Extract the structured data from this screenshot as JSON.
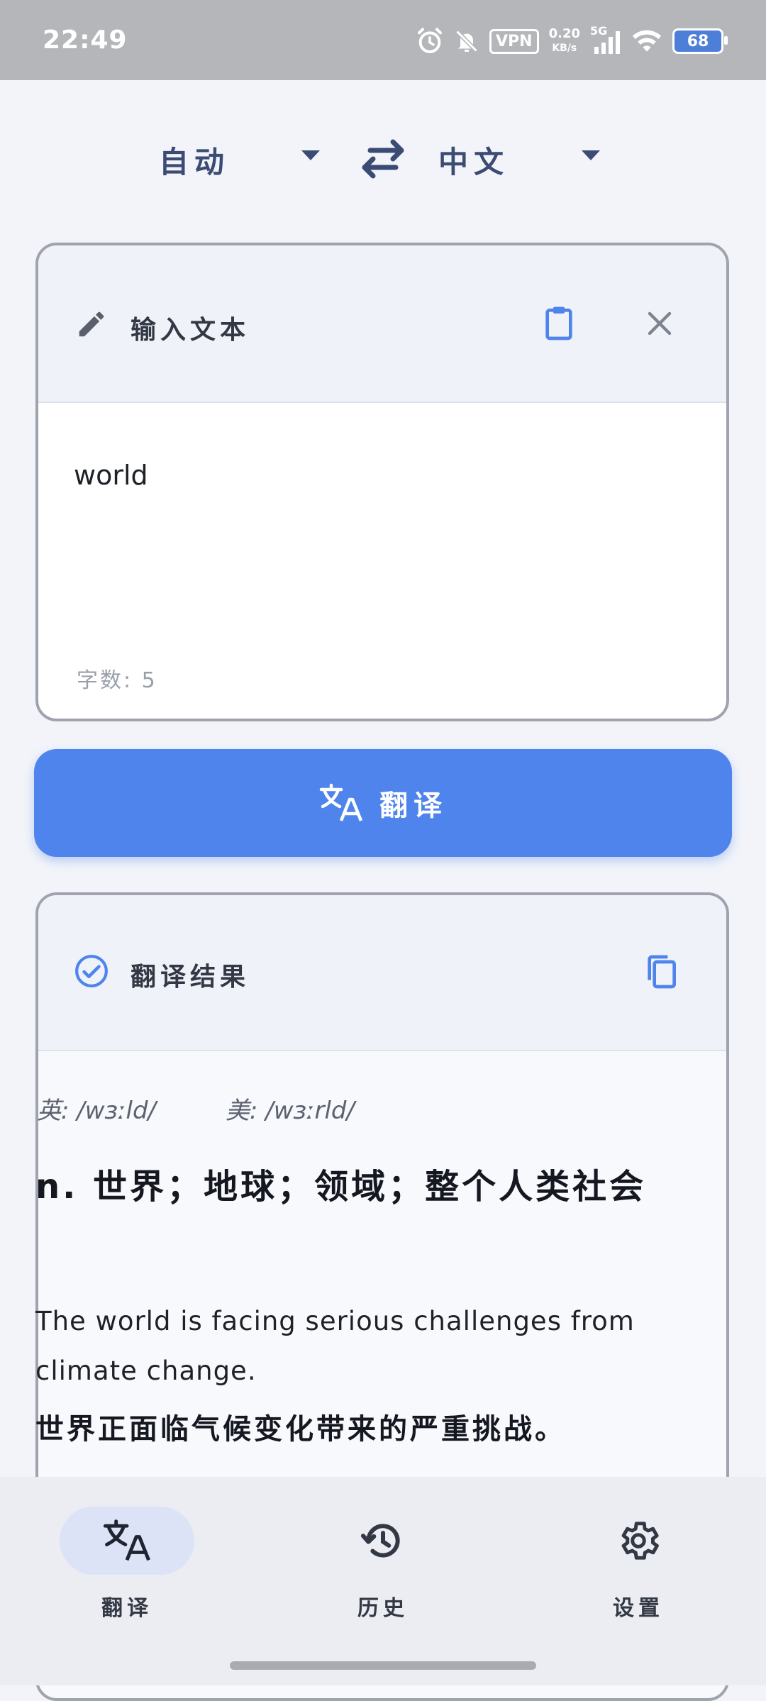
{
  "status_bar": {
    "time": "22:49",
    "vpn_label": "VPN",
    "net_speed_value": "0.20",
    "net_speed_unit": "KB/s",
    "network_type": "5G",
    "battery_level": "68"
  },
  "language_bar": {
    "source_language": "自动",
    "target_language": "中文"
  },
  "input_card": {
    "title": "输入文本",
    "input_value": "world",
    "char_count": "字数: 5"
  },
  "translate_button": {
    "label": "翻译"
  },
  "result_card": {
    "title": "翻译结果",
    "phonetic_uk": "英: /wɜːld/",
    "phonetic_us": "美: /wɜːrld/",
    "definition": "n. 世界；地球；领域；整个人类社会",
    "example_en": "The world is facing serious challenges from climate change.",
    "example_zh": "世界正面临气候变化带来的严重挑战。"
  },
  "bottom_nav": {
    "items": [
      {
        "label": "翻译",
        "icon": "translate-icon",
        "active": true
      },
      {
        "label": "历史",
        "icon": "history-icon",
        "active": false
      },
      {
        "label": "设置",
        "icon": "settings-icon",
        "active": false
      }
    ]
  },
  "colors": {
    "accent": "#4f84ec",
    "language_text": "#3b4b74",
    "status_bar_bg": "#b4b6ba",
    "page_bg": "#f2f4f9"
  }
}
